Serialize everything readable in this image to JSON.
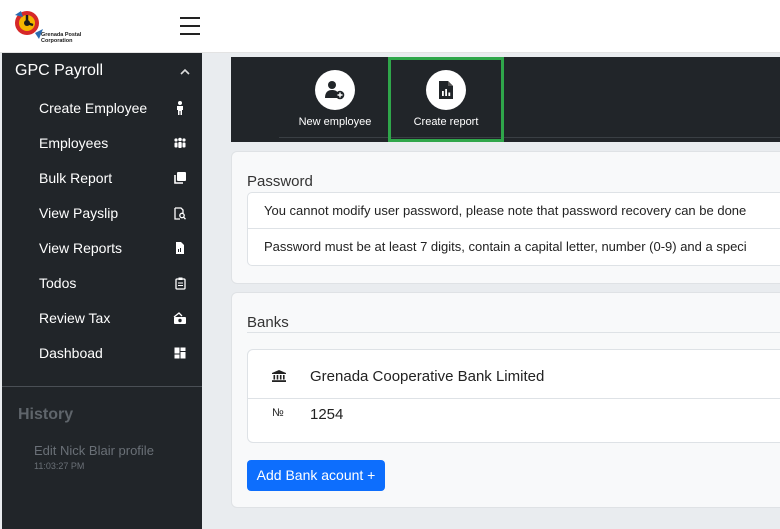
{
  "header": {
    "logo_text_line1": "Grenada Postal",
    "logo_text_line2": "Corporation"
  },
  "sidebar": {
    "section_title": "GPC Payroll",
    "items": [
      {
        "label": "Create Employee",
        "icon": "person-icon"
      },
      {
        "label": "Employees",
        "icon": "people-icon"
      },
      {
        "label": "Bulk Report",
        "icon": "copies-icon"
      },
      {
        "label": "View Payslip",
        "icon": "doc-search-icon"
      },
      {
        "label": "View Reports",
        "icon": "report-file-icon"
      },
      {
        "label": "Todos",
        "icon": "clipboard-icon"
      },
      {
        "label": "Review Tax",
        "icon": "cash-icon"
      },
      {
        "label": "Dashboad",
        "icon": "dashboard-icon"
      }
    ],
    "history_title": "History",
    "history_entry": "Edit Nick Blair profile",
    "history_time": "11:03:27 PM"
  },
  "toolbar": {
    "new_employee": "New employee",
    "create_report": "Create report"
  },
  "password_card": {
    "title": "Password",
    "notes": [
      "You cannot modify user password, please note that password recovery can be done",
      "Password must be at least 7 digits, contain a capital letter, number (0-9) and a speci"
    ]
  },
  "banks_card": {
    "title": "Banks",
    "bank_name": "Grenada Cooperative Bank Limited",
    "number_symbol": "№",
    "account_number": "1254",
    "add_button": "Add Bank acount +"
  },
  "colors": {
    "sidebar_bg": "#212529",
    "selected_outline": "#2fa64a",
    "primary_button": "#0d6efd"
  }
}
